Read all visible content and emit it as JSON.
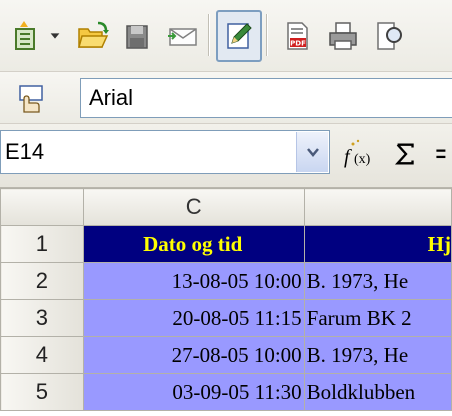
{
  "toolbar": {
    "buttons": [
      {
        "name": "new-document-icon"
      },
      {
        "name": "open-folder-icon"
      },
      {
        "name": "save-icon"
      },
      {
        "name": "email-icon"
      },
      {
        "name": "edit-file-icon",
        "active": true
      },
      {
        "name": "export-pdf-icon"
      },
      {
        "name": "print-icon"
      }
    ]
  },
  "formatting": {
    "font_name": "Arial"
  },
  "formula": {
    "cell_ref": "E14"
  },
  "grid": {
    "column_headers": [
      "C",
      ""
    ],
    "rows": [
      {
        "num": "1",
        "c": "Dato og tid",
        "d": "Hj",
        "header": true
      },
      {
        "num": "2",
        "c": "13-08-05 10:00",
        "d": "B. 1973, He"
      },
      {
        "num": "3",
        "c": "20-08-05 11:15",
        "d": "Farum BK 2"
      },
      {
        "num": "4",
        "c": "27-08-05 10:00",
        "d": "B. 1973, He"
      },
      {
        "num": "5",
        "c": "03-09-05 11:30",
        "d": "Boldklubben"
      }
    ]
  },
  "colors": {
    "header_bg": "#000080",
    "header_text": "#ffff00",
    "data_bg": "#9999ff"
  }
}
